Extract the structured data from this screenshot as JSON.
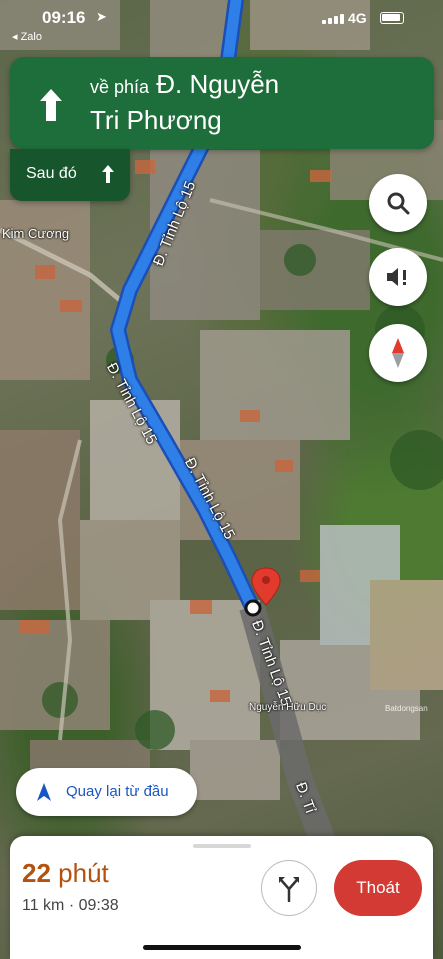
{
  "status_bar": {
    "time": "09:16",
    "back_app": "◂ Zalo",
    "network": "4G"
  },
  "nav": {
    "primary_prefix": "về phía",
    "primary_line1": "Đ. Nguyễn",
    "primary_line2": "Tri Phương",
    "then_label": "Sau đó"
  },
  "map": {
    "area_label": "Kim Cương",
    "road_labels": [
      "Đ. Tỉnh Lộ 15",
      "Đ. Tỉnh Lộ 15",
      "Đ. Tỉnh Lộ 15",
      "Đ. Tỉnh Lộ 15",
      "Đ. Tỉ"
    ],
    "poi_label": "Nguyễn Hữu Dục",
    "watermark": "Batdongsan",
    "colors": {
      "route": "#2f7fe8",
      "pin": "#e23a2c"
    }
  },
  "buttons": {
    "search_icon": "search-icon",
    "sound_icon": "speaker-alert-icon",
    "compass_icon": "compass-icon",
    "recenter_label": "Quay lại từ đầu"
  },
  "trip": {
    "duration_number": "22",
    "duration_unit": "phút",
    "distance_and_arrival": "11 km · 09:38",
    "exit_label": "Thoát",
    "colors": {
      "eta": "#b2520e",
      "exit": "#d23a33"
    }
  }
}
